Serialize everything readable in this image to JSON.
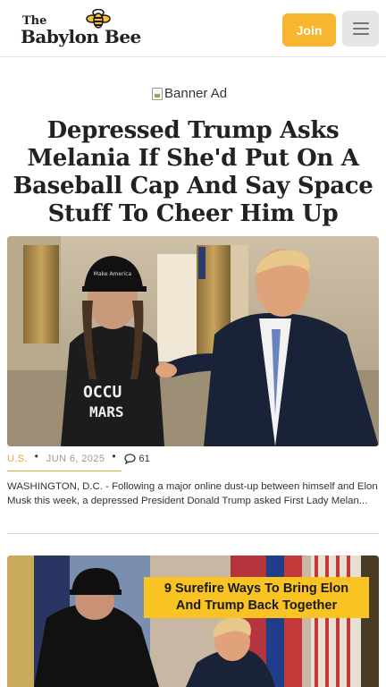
{
  "header": {
    "logo_top": "The",
    "logo_main": "Babylon Bee",
    "join_label": "Join",
    "menu_icon": "hamburger-menu-icon"
  },
  "banner": {
    "alt_text": "Banner Ad"
  },
  "article": {
    "headline": "Depressed Trump Asks Melania If She'd Put On A Baseball Cap And Say Space Stuff To Cheer Him Up",
    "image_cap_text": "Make America Great Again",
    "image_shirt_line1": "OCCU",
    "image_shirt_line2": "MARS",
    "category": "U.S.",
    "date": "JUN 6, 2025",
    "comment_count": "61",
    "excerpt": "WASHINGTON, D.C. - Following a major online dust-up between himself and Elon Musk this week, a depressed President Donald Trump asked First Lady Melan..."
  },
  "next_article": {
    "image_caption_line1": "9 Surefire Ways To Bring Elon",
    "image_caption_line2": "And Trump Back Together"
  },
  "colors": {
    "accent": "#f8b52f",
    "category": "#e0a83b",
    "caption_bg": "#f8c323"
  }
}
